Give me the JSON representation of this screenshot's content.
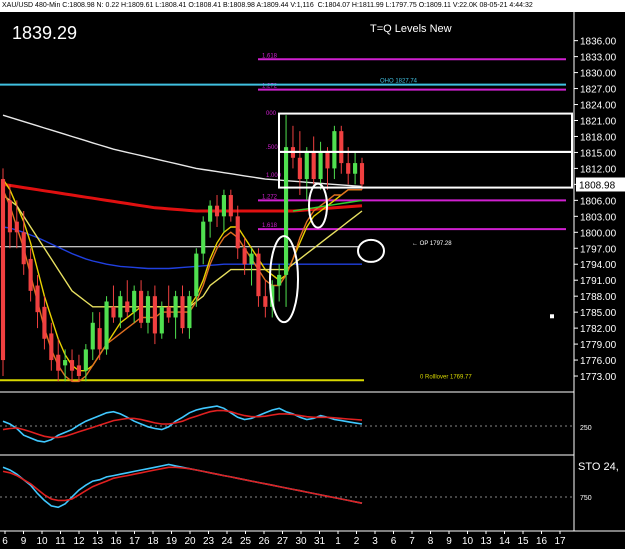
{
  "header": {
    "status_line": "XAU/USD 480-Min C:1808.98 N: 0.22 H:1809.61 L:1808.41 O:1808.41 B:1808.98 A:1809.44 V:1,116",
    "status_line2": "C:1804.07 H:1811.99 L:1797.75 O:1809.11 V:22.0K 08-05-21 4:44:32"
  },
  "display": {
    "big_price": "1839.29",
    "title": "T=Q Levels New",
    "current_price": "1808.98"
  },
  "chart_data": [
    {
      "type": "candlestick",
      "ylim": [
        1770,
        1838
      ],
      "y_ticks": [
        "1836.00",
        "1833.00",
        "1830.00",
        "1827.00",
        "1824.00",
        "1821.00",
        "1818.00",
        "1815.00",
        "1812.00",
        "1809.00",
        "1806.00",
        "1803.00",
        "1800.00",
        "1797.00",
        "1794.00",
        "1791.00",
        "1788.00",
        "1785.00",
        "1782.00",
        "1779.00",
        "1776.00",
        "1773.00"
      ],
      "x_ticks": [
        "6",
        "9",
        "10",
        "11",
        "12",
        "13",
        "16",
        "17",
        "18",
        "19",
        "20",
        "23",
        "24",
        "25",
        "26",
        "27",
        "30",
        "31",
        "1",
        "2",
        "3",
        "6",
        "7",
        "8",
        "9",
        "10",
        "13",
        "14",
        "15",
        "16",
        "17"
      ],
      "level_lines": [
        {
          "price": 1832.5,
          "label": "1.618",
          "color": "#d020d0"
        },
        {
          "price": 1826.8,
          "label": "1.272",
          "color": "#d020d0"
        },
        {
          "price": 1827.74,
          "label": "OHO 1827.74",
          "color": "#40c0e0"
        },
        {
          "price": 1806.0,
          "label": "1.272",
          "color": "#d020d0"
        },
        {
          "price": 1800.6,
          "label": "1.618",
          "color": "#d020d0"
        },
        {
          "price": 1797.28,
          "label": "OP 1797.28",
          "color": "#ffffff"
        },
        {
          "price": 1772.2,
          "label": "0 Rolllover 1769.77",
          "color": "#d8d800"
        }
      ],
      "level_labels_mid": [
        ".500",
        "1.000",
        "000"
      ],
      "candles": [
        {
          "o": 1810,
          "h": 1812,
          "l": 1773,
          "c": 1776
        },
        {
          "o": 1806,
          "h": 1809,
          "l": 1797,
          "c": 1800
        },
        {
          "o": 1802,
          "h": 1806,
          "l": 1797,
          "c": 1800
        },
        {
          "o": 1800,
          "h": 1804,
          "l": 1792,
          "c": 1794
        },
        {
          "o": 1795,
          "h": 1797,
          "l": 1787,
          "c": 1789
        },
        {
          "o": 1790,
          "h": 1792,
          "l": 1782,
          "c": 1785
        },
        {
          "o": 1786,
          "h": 1788,
          "l": 1778,
          "c": 1780
        },
        {
          "o": 1781,
          "h": 1783,
          "l": 1774,
          "c": 1776
        },
        {
          "o": 1777,
          "h": 1780,
          "l": 1772,
          "c": 1774
        },
        {
          "o": 1775,
          "h": 1778,
          "l": 1772,
          "c": 1776
        },
        {
          "o": 1776,
          "h": 1778,
          "l": 1772,
          "c": 1774
        },
        {
          "o": 1775,
          "h": 1777,
          "l": 1772,
          "c": 1773
        },
        {
          "o": 1774,
          "h": 1779,
          "l": 1772,
          "c": 1778
        },
        {
          "o": 1778,
          "h": 1785,
          "l": 1776,
          "c": 1783
        },
        {
          "o": 1782,
          "h": 1785,
          "l": 1776,
          "c": 1778
        },
        {
          "o": 1778,
          "h": 1788,
          "l": 1777,
          "c": 1787
        },
        {
          "o": 1786,
          "h": 1790,
          "l": 1783,
          "c": 1784
        },
        {
          "o": 1784,
          "h": 1789,
          "l": 1782,
          "c": 1788
        },
        {
          "o": 1787,
          "h": 1791,
          "l": 1784,
          "c": 1785
        },
        {
          "o": 1785,
          "h": 1790,
          "l": 1783,
          "c": 1789
        },
        {
          "o": 1789,
          "h": 1791,
          "l": 1782,
          "c": 1783
        },
        {
          "o": 1783,
          "h": 1789,
          "l": 1781,
          "c": 1788
        },
        {
          "o": 1788,
          "h": 1790,
          "l": 1779,
          "c": 1781
        },
        {
          "o": 1781,
          "h": 1787,
          "l": 1780,
          "c": 1786
        },
        {
          "o": 1786,
          "h": 1790,
          "l": 1783,
          "c": 1784
        },
        {
          "o": 1784,
          "h": 1789,
          "l": 1780,
          "c": 1788
        },
        {
          "o": 1788,
          "h": 1790,
          "l": 1781,
          "c": 1782
        },
        {
          "o": 1782,
          "h": 1789,
          "l": 1780,
          "c": 1788
        },
        {
          "o": 1788,
          "h": 1797,
          "l": 1786,
          "c": 1796
        },
        {
          "o": 1796,
          "h": 1803,
          "l": 1794,
          "c": 1802
        },
        {
          "o": 1802,
          "h": 1806,
          "l": 1799,
          "c": 1805
        },
        {
          "o": 1805,
          "h": 1807,
          "l": 1801,
          "c": 1803
        },
        {
          "o": 1803,
          "h": 1808,
          "l": 1800,
          "c": 1807
        },
        {
          "o": 1807,
          "h": 1808,
          "l": 1802,
          "c": 1803
        },
        {
          "o": 1803,
          "h": 1805,
          "l": 1795,
          "c": 1797
        },
        {
          "o": 1797,
          "h": 1799,
          "l": 1792,
          "c": 1794
        },
        {
          "o": 1794,
          "h": 1797,
          "l": 1790,
          "c": 1796
        },
        {
          "o": 1796,
          "h": 1797,
          "l": 1786,
          "c": 1788
        },
        {
          "o": 1788,
          "h": 1791,
          "l": 1784,
          "c": 1786
        },
        {
          "o": 1786,
          "h": 1791,
          "l": 1784,
          "c": 1790
        },
        {
          "o": 1790,
          "h": 1794,
          "l": 1787,
          "c": 1792
        },
        {
          "o": 1792,
          "h": 1822,
          "l": 1786,
          "c": 1816
        },
        {
          "o": 1816,
          "h": 1820,
          "l": 1812,
          "c": 1814
        },
        {
          "o": 1814,
          "h": 1819,
          "l": 1807,
          "c": 1810
        },
        {
          "o": 1810,
          "h": 1816,
          "l": 1806,
          "c": 1815
        },
        {
          "o": 1815,
          "h": 1818,
          "l": 1809,
          "c": 1810
        },
        {
          "o": 1810,
          "h": 1817,
          "l": 1808,
          "c": 1815
        },
        {
          "o": 1815,
          "h": 1816,
          "l": 1808,
          "c": 1812
        },
        {
          "o": 1812,
          "h": 1820,
          "l": 1810,
          "c": 1819
        },
        {
          "o": 1819,
          "h": 1820,
          "l": 1811,
          "c": 1813
        },
        {
          "o": 1813,
          "h": 1816,
          "l": 1809,
          "c": 1811
        },
        {
          "o": 1811,
          "h": 1815,
          "l": 1809,
          "c": 1813
        },
        {
          "o": 1813,
          "h": 1814,
          "l": 1808,
          "c": 1809
        }
      ],
      "moving_averages": [
        {
          "name": "white",
          "color": "#e8e8e8",
          "values": [
            1822,
            1821.6,
            1821.2,
            1820.8,
            1820.4,
            1820,
            1819.6,
            1819.2,
            1818.8,
            1818.4,
            1818,
            1817.6,
            1817.2,
            1816.8,
            1816.4,
            1816,
            1815.6,
            1815.3,
            1815,
            1814.7,
            1814.4,
            1814.1,
            1813.8,
            1813.5,
            1813.2,
            1812.9,
            1812.6,
            1812.3,
            1812,
            1811.8,
            1811.6,
            1811.4,
            1811.2,
            1811,
            1810.8,
            1810.6,
            1810.4,
            1810.2,
            1810,
            1809.9,
            1809.8,
            1809.7,
            1809.6,
            1809.5,
            1809.4,
            1809.3,
            1809.2,
            1809.1,
            1809,
            1808.9,
            1808.8,
            1808.7,
            1808.6
          ]
        },
        {
          "name": "red",
          "color": "#e01010",
          "values": [
            1809,
            1808.8,
            1808.6,
            1808.4,
            1808.2,
            1808,
            1807.8,
            1807.6,
            1807.4,
            1807.2,
            1807,
            1806.8,
            1806.6,
            1806.4,
            1806.2,
            1806,
            1805.8,
            1805.6,
            1805.4,
            1805.2,
            1805,
            1804.8,
            1804.6,
            1804.5,
            1804.4,
            1804.3,
            1804.2,
            1804.1,
            1804,
            1804,
            1804,
            1804,
            1804,
            1804,
            1804,
            1804,
            1804,
            1804,
            1804,
            1804,
            1804,
            1804,
            1804,
            1804.1,
            1804.2,
            1804.3,
            1804.4,
            1804.5,
            1804.6,
            1804.7,
            1804.8,
            1804.9,
            1805
          ]
        },
        {
          "name": "blue",
          "color": "#2040e0",
          "values": [
            1801,
            1800.8,
            1800.4,
            1800,
            1799.5,
            1799,
            1798.4,
            1797.8,
            1797.2,
            1796.6,
            1796,
            1795.5,
            1795,
            1794.6,
            1794.3,
            1794,
            1793.8,
            1793.6,
            1793.5,
            1793.4,
            1793.3,
            1793.2,
            1793.2,
            1793.2,
            1793.2,
            1793.3,
            1793.4,
            1793.5,
            1793.6,
            1793.7,
            1793.8,
            1793.9,
            1794,
            1794,
            1794,
            1794,
            1794,
            1794,
            1794,
            1794,
            1794,
            1794,
            1794,
            1794,
            1794,
            1794,
            1794,
            1794,
            1794,
            1794,
            1794,
            1794,
            1794
          ]
        },
        {
          "name": "yellow_fast",
          "color": "#e8d000",
          "values": [
            1810,
            1808,
            1805,
            1802,
            1798,
            1793,
            1788,
            1784,
            1780,
            1777,
            1775,
            1774,
            1774,
            1775,
            1777,
            1779,
            1781,
            1783,
            1784,
            1785,
            1786,
            1786,
            1786,
            1786,
            1786,
            1786,
            1786,
            1786,
            1788,
            1791,
            1795,
            1798,
            1800,
            1801,
            1801,
            1799,
            1797,
            1795,
            1793,
            1792,
            1791,
            1792,
            1795,
            1798,
            1801,
            1803,
            1804,
            1805,
            1806,
            1807,
            1808,
            1808,
            1808
          ]
        },
        {
          "name": "yellow_slow",
          "color": "#e8e060",
          "values": [
            1807,
            1806,
            1805,
            1803,
            1801,
            1799,
            1797,
            1795,
            1793,
            1791,
            1789,
            1788,
            1787,
            1786,
            1786,
            1786,
            1786,
            1786,
            1786,
            1786,
            1786,
            1786,
            1786,
            1786,
            1786,
            1786,
            1786,
            1786,
            1787,
            1788,
            1790,
            1791,
            1792,
            1793,
            1793,
            1793,
            1793,
            1793,
            1793,
            1793,
            1793,
            1793,
            1794,
            1795,
            1796,
            1797,
            1798,
            1799,
            1800,
            1801,
            1802,
            1803,
            1804
          ]
        },
        {
          "name": "orange",
          "color": "#e07020",
          "values": [
            1808,
            1805,
            1801,
            1797,
            1792,
            1787,
            1782,
            1778,
            1775,
            1773,
            1772,
            1772,
            1773,
            1775,
            1777,
            1779,
            1780,
            1781,
            1782,
            1783,
            1784,
            1784,
            1784,
            1785,
            1785,
            1785,
            1785,
            1785,
            1787,
            1790,
            1794,
            1797,
            1799,
            1800,
            1799,
            1797,
            1795,
            1793,
            1791,
            1790,
            1790,
            1792,
            1795,
            1799,
            1802,
            1804,
            1805,
            1806,
            1807,
            1807,
            1808,
            1808,
            1808
          ]
        },
        {
          "name": "green",
          "color": "#30d030",
          "values": [
            null,
            null,
            null,
            null,
            null,
            null,
            null,
            null,
            null,
            null,
            null,
            null,
            null,
            null,
            null,
            null,
            null,
            null,
            null,
            null,
            null,
            null,
            null,
            null,
            null,
            null,
            null,
            null,
            null,
            null,
            null,
            null,
            null,
            null,
            null,
            null,
            null,
            null,
            null,
            null,
            null,
            null,
            1804,
            1804.2,
            1804.4,
            1804.6,
            1804.8,
            1805,
            1805.2,
            1805.4,
            1805.6,
            1805.8,
            1806
          ]
        }
      ]
    },
    {
      "type": "line",
      "panel": "oscillator",
      "tick_labels": [
        "250"
      ],
      "series": [
        {
          "color": "#40c8ff",
          "values": [
            55,
            50,
            42,
            30,
            25,
            20,
            18,
            22,
            30,
            35,
            40,
            48,
            55,
            60,
            65,
            70,
            72,
            68,
            62,
            55,
            50,
            45,
            42,
            40,
            45,
            55,
            62,
            70,
            75,
            78,
            80,
            82,
            78,
            70,
            62,
            58,
            60,
            65,
            70,
            75,
            78,
            72,
            68,
            62,
            58,
            60,
            65,
            62,
            58,
            56,
            54,
            52,
            50
          ]
        },
        {
          "color": "#e02020",
          "values": [
            40,
            42,
            43,
            40,
            36,
            32,
            28,
            26,
            26,
            28,
            32,
            36,
            40,
            44,
            48,
            52,
            56,
            58,
            60,
            60,
            58,
            55,
            52,
            50,
            50,
            52,
            55,
            60,
            64,
            68,
            72,
            74,
            74,
            72,
            68,
            65,
            63,
            63,
            64,
            66,
            68,
            68,
            67,
            65,
            63,
            62,
            62,
            62,
            61,
            60,
            59,
            58,
            57
          ]
        }
      ]
    },
    {
      "type": "line",
      "panel": "stochastic",
      "label": "STO 24,",
      "tick_labels": [
        "750"
      ],
      "series": [
        {
          "color": "#40c8ff",
          "values": [
            88,
            84,
            78,
            70,
            62,
            50,
            40,
            32,
            30,
            35,
            45,
            55,
            62,
            68,
            70,
            74,
            76,
            78,
            80,
            82,
            84,
            86,
            88,
            90,
            92,
            90,
            88,
            86,
            84,
            82,
            80,
            78,
            76,
            74,
            72,
            70,
            68,
            66,
            64,
            62,
            60,
            58,
            56,
            54,
            52,
            50,
            48,
            46,
            44,
            42,
            40,
            38,
            36
          ]
        },
        {
          "color": "#e02020",
          "values": [
            82,
            80,
            76,
            70,
            64,
            56,
            48,
            42,
            40,
            40,
            42,
            48,
            54,
            60,
            64,
            68,
            72,
            74,
            76,
            78,
            80,
            82,
            84,
            86,
            88,
            88,
            87,
            86,
            84,
            82,
            80,
            78,
            76,
            74,
            72,
            70,
            68,
            66,
            64,
            62,
            60,
            58,
            56,
            54,
            52,
            50,
            48,
            46,
            44,
            42,
            40,
            38,
            36
          ]
        }
      ]
    }
  ]
}
